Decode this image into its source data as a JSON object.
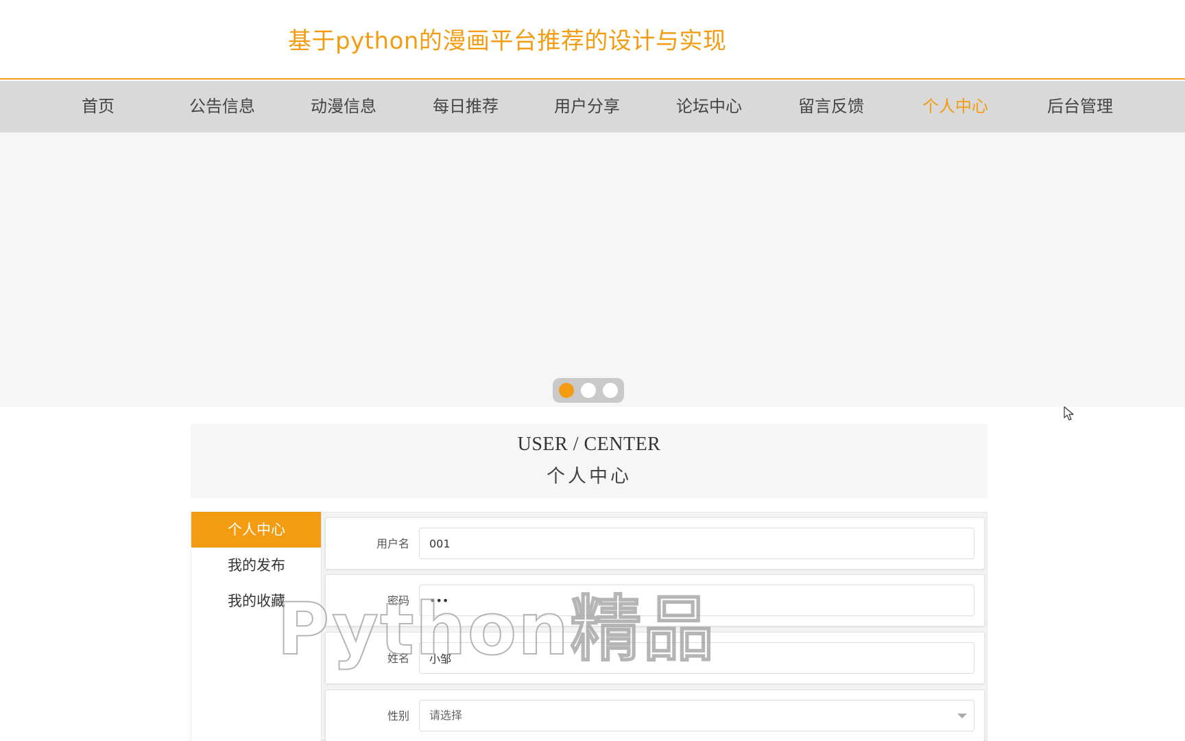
{
  "header": {
    "title": "基于python的漫画平台推荐的设计与实现"
  },
  "nav": {
    "items": [
      {
        "label": "首页"
      },
      {
        "label": "公告信息"
      },
      {
        "label": "动漫信息"
      },
      {
        "label": "每日推荐"
      },
      {
        "label": "用户分享"
      },
      {
        "label": "论坛中心"
      },
      {
        "label": "留言反馈"
      },
      {
        "label": "个人中心",
        "active": true
      },
      {
        "label": "后台管理"
      }
    ]
  },
  "carousel": {
    "slide_count": 3,
    "active_index": 0
  },
  "section": {
    "title_en": "USER / CENTER",
    "title_cn": "个人中心"
  },
  "sidebar": {
    "items": [
      {
        "label": "个人中心",
        "active": true
      },
      {
        "label": "我的发布"
      },
      {
        "label": "我的收藏"
      }
    ]
  },
  "form": {
    "username": {
      "label": "用户名",
      "value": "001"
    },
    "password": {
      "label": "密码",
      "value": "•••"
    },
    "name": {
      "label": "姓名",
      "value": "小邹"
    },
    "gender": {
      "label": "性别",
      "value": "请选择"
    }
  },
  "watermark": {
    "text": "Python精品"
  },
  "colors": {
    "accent": "#f39c12",
    "nav_bg": "#d9d9d9"
  }
}
